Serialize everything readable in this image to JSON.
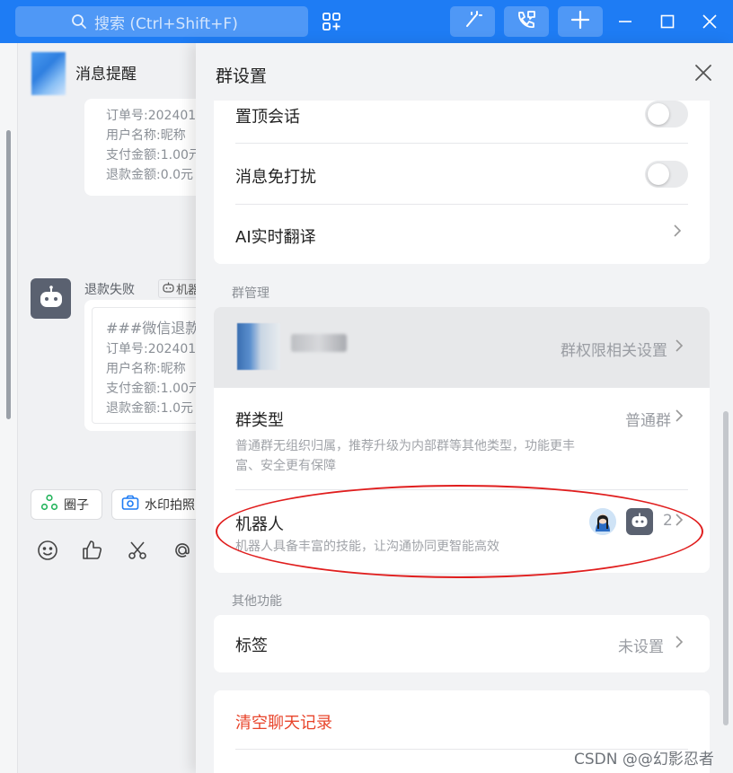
{
  "titlebar": {
    "search_placeholder": "搜索 (Ctrl+Shift+F)",
    "icons": [
      "search-icon",
      "apps-grid-icon",
      "magic-wand-icon",
      "phone-call-icon",
      "plus-icon",
      "minimize-icon",
      "maximize-icon",
      "close-icon"
    ],
    "accent": "#1e7cf4"
  },
  "chat": {
    "title": "消息提醒",
    "message1": {
      "lines": [
        "订单号:202401",
        "用户名称:昵称",
        "支付金额:1.00元",
        "退款金额:0.0元"
      ]
    },
    "message2": {
      "sender": "退款失败",
      "tag": "机器",
      "lines": [
        "###微信退款",
        "订单号:202401",
        "用户名称:昵称",
        "支付金额:1.00元",
        "退款金额:1.0元"
      ]
    },
    "chips": [
      {
        "label": "圈子",
        "icon": "circle-icon"
      },
      {
        "label": "水印拍照",
        "icon": "camera-icon"
      }
    ],
    "toolbar_icons": [
      "emoji-icon",
      "thumbs-up-icon",
      "scissors-icon",
      "at-icon"
    ]
  },
  "panel": {
    "title": "群设置",
    "settings": {
      "pin_label": "置顶会话",
      "pin_on": false,
      "mute_label": "消息免打扰",
      "mute_on": false,
      "translate_label": "AI实时翻译"
    },
    "group_mgmt": {
      "section_label": "群管理",
      "permissions_link": "群权限相关设置",
      "type_label": "群类型",
      "type_value": "普通群",
      "type_desc": "普通群无组织归属，推荐升级为内部群等其他类型，功能更丰富、安全更有保障",
      "robot_label": "机器人",
      "robot_count": "2",
      "robot_desc": "机器人具备丰富的技能，让沟通协同更智能高效"
    },
    "other": {
      "section_label": "其他功能",
      "tag_label": "标签",
      "tag_value": "未设置"
    },
    "danger": {
      "clear_label": "清空聊天记录",
      "danger_color": "#e8452c"
    }
  },
  "watermark": "CSDN @@幻影忍者"
}
